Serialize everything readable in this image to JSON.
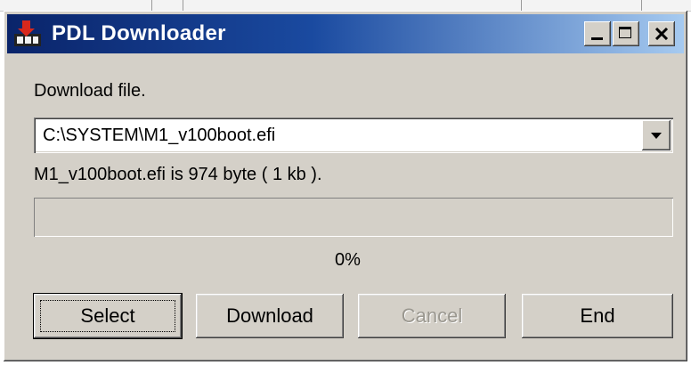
{
  "window": {
    "title": "PDL Downloader",
    "icon": "pdl-downloader-app-icon",
    "controls": [
      "minimize-icon",
      "maximize-icon",
      "close-icon"
    ]
  },
  "dialog": {
    "download_label": "Download file.",
    "file_combo": {
      "value": "C:\\SYSTEM\\M1_v100boot.efi"
    },
    "file_info": "M1_v100boot.efi is 974 byte ( 1 kb ).",
    "progress": {
      "fraction": 0,
      "percent_text": "0%"
    },
    "buttons": {
      "select": "Select",
      "download": "Download",
      "cancel": "Cancel",
      "end": "End"
    }
  },
  "colors": {
    "titlebar_start": "#0a246a",
    "titlebar_end": "#a6caf0",
    "face": "#d4d0c8",
    "progress_fill": "#0a246a"
  }
}
